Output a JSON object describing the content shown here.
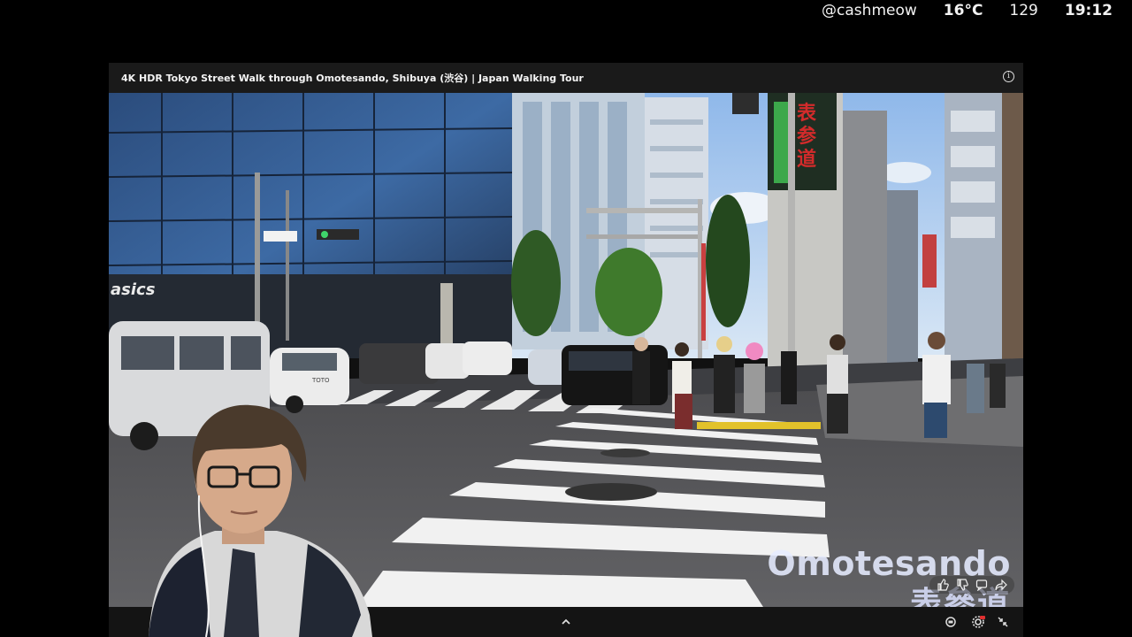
{
  "hud": {
    "handle": "@cashmeow",
    "temperature": "16°C",
    "viewers": "129",
    "clock": "19:12"
  },
  "player": {
    "title": "4K HDR Tokyo Street Walk through Omotesando, Shibuya (渋谷) | Japan Walking Tour",
    "info_glyph": "i",
    "location_en": "Omotesando",
    "location_jp": "表參道"
  },
  "scene_signs": {
    "asics": "asics",
    "toto": "TOTO"
  },
  "icons": {
    "like": "thumbs-up-icon",
    "dislike": "thumbs-down-icon",
    "comment": "comment-icon",
    "share": "share-icon",
    "expand": "chevron-up-icon",
    "subtitles": "captions-icon",
    "settings": "gear-icon",
    "minimize": "collapse-icon"
  },
  "colors": {
    "sky": "#9fc3ef",
    "road": "#5a5a5c",
    "sign_red": "#d32b2b"
  }
}
